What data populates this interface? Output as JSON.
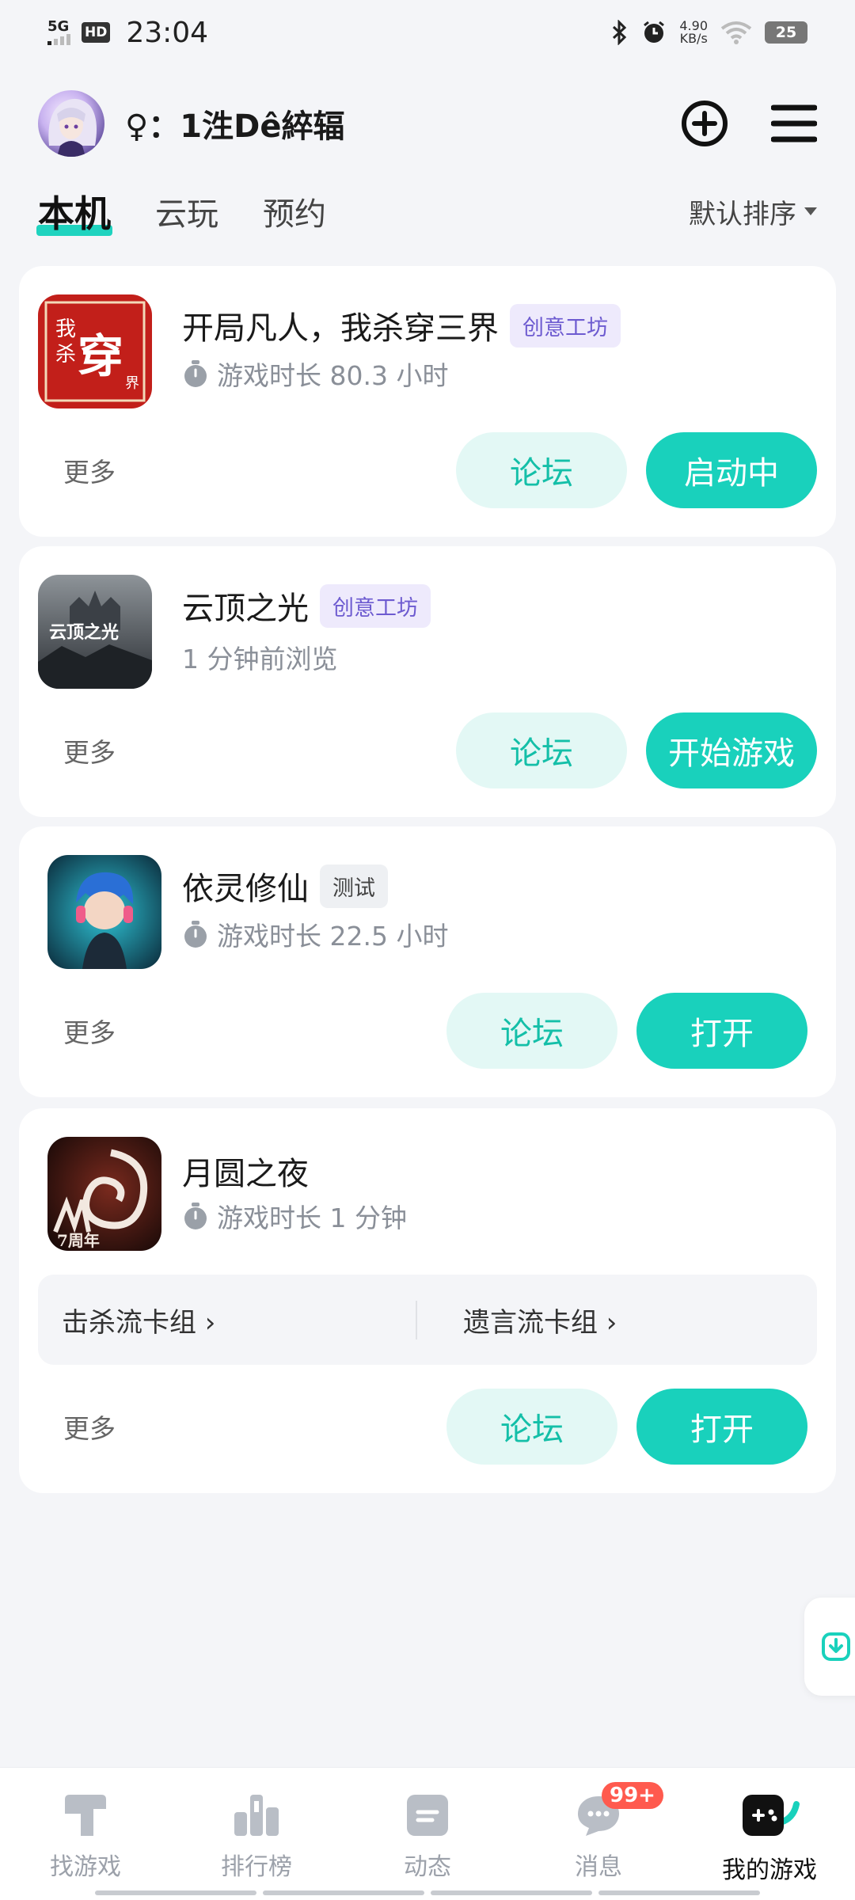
{
  "status_bar": {
    "network": "5G",
    "hd": "HD",
    "time": "23:04",
    "speed_value": "4.90",
    "speed_unit": "KB/s",
    "battery": "25"
  },
  "header": {
    "username": "♀：1泩Dê綷辐"
  },
  "tabs": [
    {
      "label": "本机",
      "active": true
    },
    {
      "label": "云玩",
      "active": false
    },
    {
      "label": "预约",
      "active": false
    }
  ],
  "sort_label": "默认排序",
  "games": [
    {
      "title": "开局凡人，我杀穿三界",
      "tag": "创意工坊",
      "subtitle": "游戏时长 80.3 小时",
      "more": "更多",
      "forum": "论坛",
      "action": "启动中"
    },
    {
      "title": "云顶之光",
      "tag": "创意工坊",
      "subtitle": "1 分钟前浏览",
      "more": "更多",
      "forum": "论坛",
      "action": "开始游戏"
    },
    {
      "title": "依灵修仙",
      "tag": "测试",
      "subtitle": "游戏时长 22.5 小时",
      "more": "更多",
      "forum": "论坛",
      "action": "打开"
    },
    {
      "title": "月圆之夜",
      "subtitle": "游戏时长 1 分钟",
      "decks": [
        "击杀流卡组 ›",
        "遗言流卡组 ›"
      ],
      "more": "更多",
      "forum": "论坛",
      "action": "打开"
    }
  ],
  "bottom_nav": [
    {
      "label": "找游戏",
      "icon": "find-game-icon"
    },
    {
      "label": "排行榜",
      "icon": "ranking-icon"
    },
    {
      "label": "动态",
      "icon": "feed-icon"
    },
    {
      "label": "消息",
      "icon": "message-icon",
      "badge": "99+"
    },
    {
      "label": "我的游戏",
      "icon": "gamepad-icon",
      "active": true
    }
  ],
  "colors": {
    "accent": "#19d1bc",
    "forum_bg": "#e3f8f5",
    "creative_tag_bg": "#eeeafc",
    "badge": "#ff5a4e"
  }
}
